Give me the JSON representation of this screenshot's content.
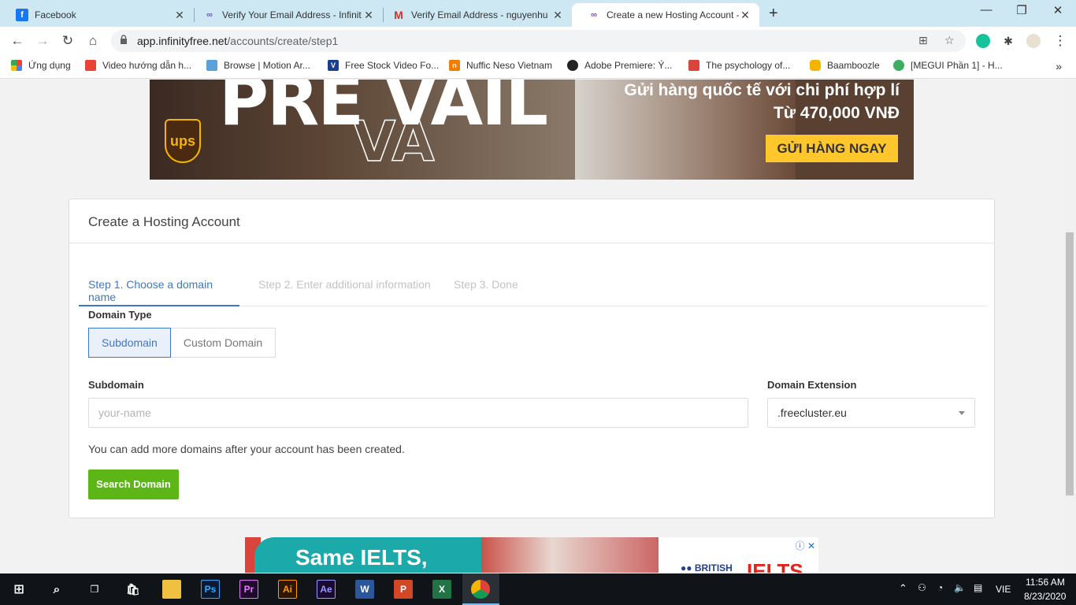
{
  "browser": {
    "tabs": [
      {
        "title": "Facebook",
        "icon": "facebook-icon"
      },
      {
        "title": "Verify Your Email Address - Infinit",
        "icon": "infinityfree-icon"
      },
      {
        "title": "Verify Email Address - nguyenhu",
        "icon": "gmail-icon"
      },
      {
        "title": "Create a new Hosting Account - I",
        "icon": "infinityfree-icon",
        "active": true
      }
    ],
    "new_tab": "+",
    "url_host": "app.infinityfree.net",
    "url_path": "/accounts/create/step1",
    "window_controls": {
      "minimize": "—",
      "maximize": "❐",
      "close": "✕"
    }
  },
  "bookmarks": [
    {
      "label": "Ứng dụng",
      "color": "#e94335"
    },
    {
      "label": "Video hướng dẫn h...",
      "color": "#e94335"
    },
    {
      "label": "Browse | Motion Ar...",
      "color": "#5da0d8"
    },
    {
      "label": "Free Stock Video Fo...",
      "color": "#1b3f8b"
    },
    {
      "label": "Nuffic Neso Vietnam",
      "color": "#f07d00"
    },
    {
      "label": "Adobe Premiere: Ý...",
      "color": "#222222"
    },
    {
      "label": "The psychology of...",
      "color": "#d9453c"
    },
    {
      "label": "Baamboozle",
      "color": "#f5b400"
    },
    {
      "label": "[MEGUI Phần 1] - H...",
      "color": "#3dae60"
    }
  ],
  "bookmarks_more": "»",
  "ad_top": {
    "big_text": "PRE VAIL",
    "outline_text": "VA",
    "logo": "ups",
    "line1": "Gửi hàng quốc tế với chi phí hợp lí",
    "line2": "Từ 470,000 VNĐ",
    "cta": "GỬI HÀNG NGAY"
  },
  "form": {
    "title": "Create a Hosting Account",
    "steps": [
      {
        "label": "Step 1. Choose a domain name",
        "active": true
      },
      {
        "label": "Step 2. Enter additional information",
        "active": false
      },
      {
        "label": "Step 3. Done",
        "active": false
      }
    ],
    "domain_type_label": "Domain Type",
    "domain_type_options": [
      "Subdomain",
      "Custom Domain"
    ],
    "domain_type_selected": "Subdomain",
    "subdomain_label": "Subdomain",
    "subdomain_placeholder": "your-name",
    "subdomain_value": "",
    "extension_label": "Domain Extension",
    "extension_value": ".freecluster.eu",
    "help_text": "You can add more domains after your account has been created.",
    "search_button": "Search Domain"
  },
  "ad_bottom": {
    "headline": "Same IELTS,",
    "brand": "BRITISH",
    "ielts": "IELTS"
  },
  "taskbar": {
    "language": "VIE",
    "time": "11:56 AM",
    "date": "8/23/2020"
  },
  "colors": {
    "accent": "#3c78c8",
    "search_button": "#5cb615",
    "tabstrip": "#cde8f3"
  }
}
